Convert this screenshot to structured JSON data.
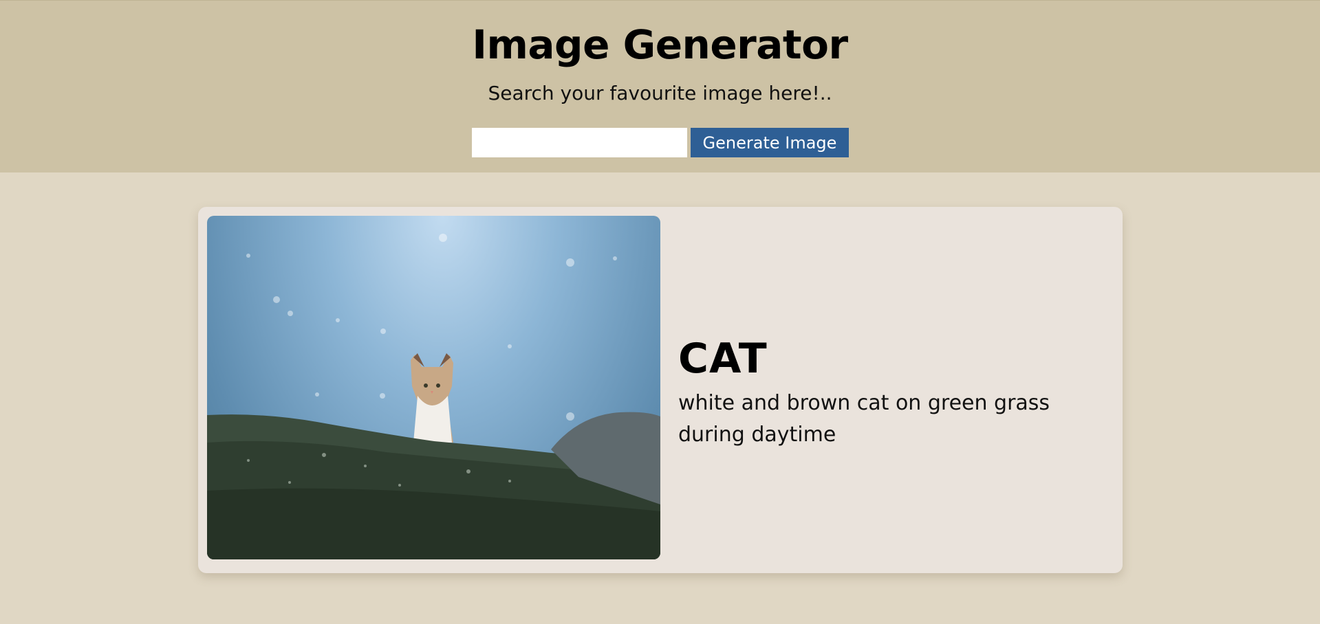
{
  "header": {
    "title": "Image Generator",
    "subtitle": "Search your favourite image here!..",
    "search": {
      "value": "",
      "placeholder": ""
    },
    "button_label": "Generate Image"
  },
  "result": {
    "title": "CAT",
    "description": "white and brown cat on green grass during daytime"
  },
  "colors": {
    "header_bg": "#cdc2a5",
    "page_bg": "#e0d7c4",
    "card_bg": "#eae3dc",
    "button_bg": "#2e5f95"
  }
}
